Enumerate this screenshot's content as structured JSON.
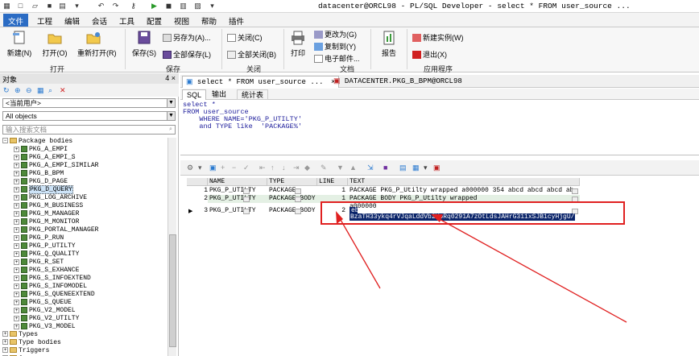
{
  "window": {
    "title": "datacenter@ORCL98 - PL/SQL Developer - select * FROM user_source ..."
  },
  "menu": {
    "tabs": [
      "文件",
      "工程",
      "编辑",
      "会话",
      "工具",
      "配置",
      "视图",
      "帮助",
      "插件"
    ],
    "active_index": 0
  },
  "ribbon": {
    "buttons": {
      "new": "新建(N)",
      "open": "打开(O)",
      "reopen": "重新打开(R)",
      "save": "保存(S)",
      "save_as": "另存为(A)...",
      "save_all": "全部保存(L)",
      "close": "关闭(C)",
      "close_all": "全部关闭(B)",
      "print": "打印",
      "change_to": "更改为(G)",
      "copy_to": "复制到(Y)",
      "email": "电子邮件...",
      "report": "报告",
      "new_instance": "新建实例(W)",
      "exit": "退出(X)"
    },
    "groups": {
      "open": "打开",
      "save": "保存",
      "close": "关闭",
      "document": "文档",
      "application": "应用程序"
    }
  },
  "left_panel": {
    "title": "对象",
    "pin": "4 ×",
    "user_combo": "<当前用户>",
    "objects_combo": "All objects",
    "search_placeholder": "输入搜索文档",
    "tree": {
      "root": "Package bodies",
      "items": [
        "PKG_A_EMPI",
        "PKG_A_EMPI_S",
        "PKG_A_EMPI_SIMILAR",
        "PKG_B_BPM",
        "PKG_D_PAGE",
        "PKG_D_QUERY",
        "PKG_LOG_ARCHIVE",
        "PKG_M_BUSINESS",
        "PKG_M_MANAGER",
        "PKG_M_MONITOR",
        "PKG_PORTAL_MANAGER",
        "PKG_P_RUN",
        "PKG_P_UTILTY",
        "PKG_Q_QUALITY",
        "PKG_R_SET",
        "PKG_S_EXHANCE",
        "PKG_S_INFOEXTEND",
        "PKG_S_INFOMODEL",
        "PKG_S_QUENEEXTEND",
        "PKG_S_QUEUE",
        "PKG_V2_MODEL",
        "PKG_V2_UTILTY",
        "PKG_V3_MODEL"
      ],
      "selected": "PKG_D_QUERY",
      "bottom": [
        "Types",
        "Type bodies",
        "Triggers",
        "Java sources"
      ]
    }
  },
  "doc_tabs": [
    "select * FROM user_source ...",
    "DATACENTER.PKG_B_BPM@ORCL98"
  ],
  "sub_tabs": [
    "SQL",
    "输出",
    "统计表"
  ],
  "editor": {
    "lines": [
      "select *",
      "FROM user_source",
      "    WHERE NAME='PKG_P_UTILTY'",
      "    and TYPE like  'PACKAGE%'"
    ]
  },
  "grid": {
    "columns": [
      "NAME",
      "TYPE",
      "LINE",
      "TEXT"
    ],
    "rows": [
      {
        "num": "1",
        "name": "PKG_P_UTILTY",
        "type": "PACKAGE",
        "line": "1",
        "text": "PACKAGE PKG_P_Utilty wrapped  a000000 354 abcd abcd abcd ab"
      },
      {
        "num": "2",
        "name": "PKG_P_UTILTY",
        "type": "PACKAGE BODY",
        "line": "1",
        "text": "PACKAGE BODY PKG_P_Utilty wrapped"
      },
      {
        "num": "",
        "name": "",
        "type": "",
        "line": "",
        "text": "a000000"
      },
      {
        "num": "3",
        "name": "PKG_P_UTILTY",
        "type": "PACKAGE BODY",
        "line": "2",
        "text": "eb"
      },
      {
        "num": "",
        "name": "",
        "type": "",
        "line": "",
        "text": "BzaTH33ykq4rVJqaLddVb2YpRq0291A7zOtLdsJAHrG311xSJB1cyHjgU/T"
      }
    ]
  },
  "colors": {
    "accent": "#2b6cc4",
    "highlight": "#0a246a",
    "annotation": "#e02020"
  }
}
